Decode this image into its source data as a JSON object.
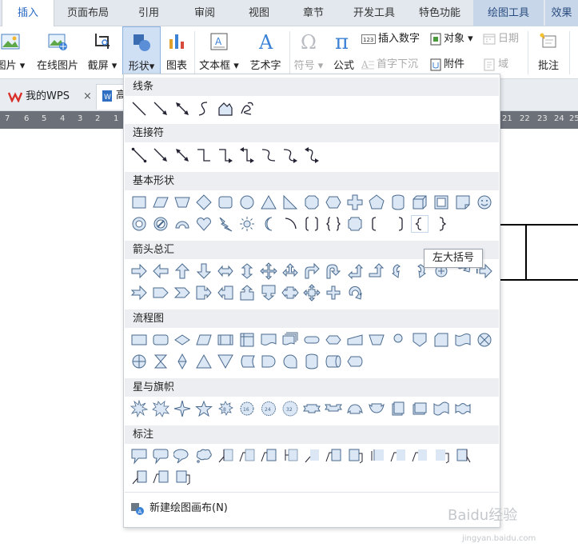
{
  "tabs": {
    "insert": "插入",
    "layout": "页面布局",
    "references": "引用",
    "review": "审阅",
    "view": "视图",
    "chapter": "章节",
    "developer": "开发工具",
    "features": "特色功能",
    "drawing_tools": "绘图工具",
    "effects": "效果"
  },
  "ribbon": {
    "picture": "图片",
    "online_picture": "在线图片",
    "screenshot": "截屏",
    "shapes": "形状",
    "chart": "图表",
    "textbox": "文本框",
    "wordart": "艺术字",
    "symbol": "符号",
    "formula": "公式",
    "insert_number": "插入数字",
    "object": "对象",
    "date": "日期",
    "drop_cap": "首字下沉",
    "attachment": "附件",
    "field": "域",
    "comment": "批注"
  },
  "doctabs": {
    "my_wps": "我的WPS",
    "doc_partial": "高"
  },
  "ruler_left": [
    "7",
    "6",
    "5",
    "4",
    "3",
    "2",
    "1"
  ],
  "ruler_right": [
    "21",
    "22",
    "23",
    "24",
    "25"
  ],
  "dropdown": {
    "lines": "线条",
    "connectors": "连接符",
    "basic_shapes": "基本形状",
    "block_arrows": "箭头总汇",
    "flowchart": "流程图",
    "stars_banners": "星与旗帜",
    "callouts": "标注",
    "new_canvas": "新建绘图画布(N)",
    "tooltip": "左大括号"
  },
  "watermark": "Baidu经验",
  "watermark_url": "jingyan.baidu.com",
  "colors": {
    "accent": "#2b6bc5",
    "ribbon_selected": "#cfe0f5",
    "section_header": "#eceef1",
    "shape_stroke": "#4a6a8e",
    "shape_fill": "#dbe7f4"
  }
}
